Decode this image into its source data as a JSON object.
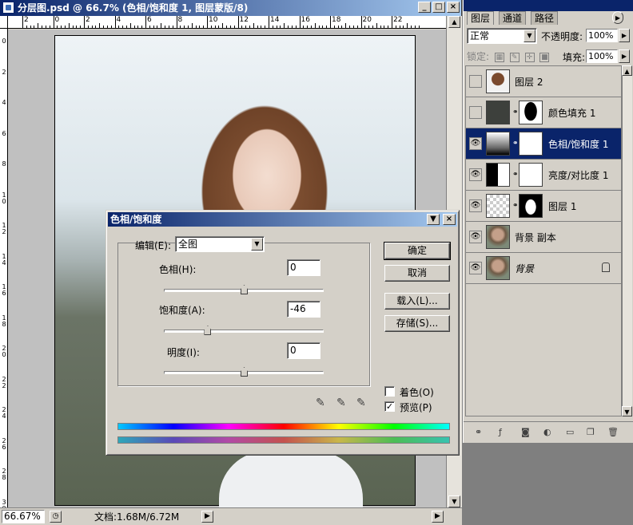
{
  "document": {
    "title": "分层图.psd @ 66.7% (色相/饱和度 1, 图层蒙版/8)",
    "win_min": "_",
    "win_max": "□",
    "win_close": "×",
    "ruler_h": [
      "2",
      "0",
      "2",
      "4",
      "6",
      "8",
      "10",
      "12",
      "14",
      "16",
      "18",
      "20",
      "22"
    ],
    "ruler_v": [
      "0",
      "2",
      "4",
      "6",
      "8",
      "1 0",
      "1 2",
      "1 4",
      "1 6",
      "1 8",
      "2 0",
      "2 2",
      "2 4",
      "2 6",
      "2 8",
      "3 0"
    ],
    "zoom": "66.67%",
    "docinfo": "文档:1.68M/6.72M"
  },
  "dialog": {
    "title": "色相/饱和度",
    "edit_label": "编辑(E):",
    "edit_value": "全图",
    "hue_label": "色相(H):",
    "hue_value": "0",
    "hue_level": 0.5,
    "saturation_label": "饱和度(A):",
    "saturation_value": "-46",
    "saturation_level": 0.27,
    "lightness_label": "明度(I):",
    "lightness_value": "0",
    "lightness_level": 0.5,
    "ok": "确定",
    "cancel": "取消",
    "load": "载入(L)...",
    "save": "存储(S)...",
    "colorize_label": "着色(O)",
    "colorize_checked": false,
    "preview_label": "预览(P)",
    "preview_checked": true
  },
  "layers_panel": {
    "tabs": [
      "图层",
      "通道",
      "路径"
    ],
    "blend_mode": "正常",
    "opacity_label": "不透明度:",
    "opacity_value": "100%",
    "lock_label": "锁定:",
    "fill_label": "填充:",
    "fill_value": "100%",
    "layers": [
      {
        "name": "图层 2",
        "visible": false,
        "selected": false
      },
      {
        "name": "颜色填充 1",
        "visible": false,
        "selected": false
      },
      {
        "name": "色相/饱和度 1",
        "visible": true,
        "selected": true
      },
      {
        "name": "亮度/对比度 1",
        "visible": true,
        "selected": false
      },
      {
        "name": "图层 1",
        "visible": true,
        "selected": false
      },
      {
        "name": "背景 副本",
        "visible": true,
        "selected": false
      },
      {
        "name": "背景",
        "visible": true,
        "selected": false
      }
    ]
  }
}
